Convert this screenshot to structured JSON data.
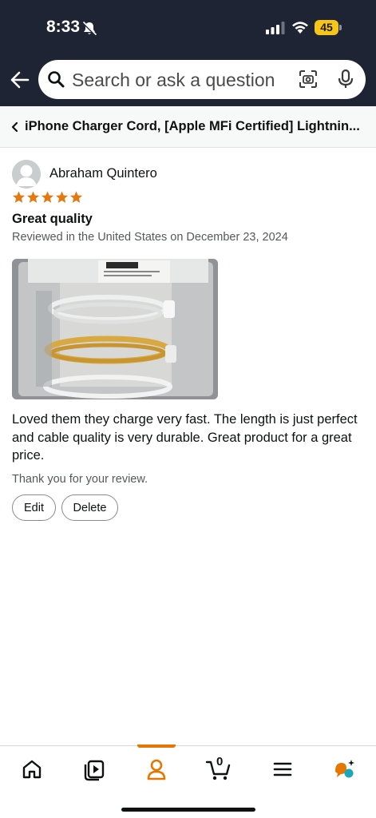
{
  "status_bar": {
    "time": "8:33",
    "battery": "45"
  },
  "search": {
    "placeholder": "Search or ask a question"
  },
  "breadcrumb": {
    "title": "iPhone Charger Cord, [Apple MFi Certified] Lightnin..."
  },
  "review": {
    "reviewer": "Abraham Quintero",
    "rating": 5,
    "rating_max": 5,
    "title": "Great quality",
    "date": "Reviewed in the United States on December 23, 2024",
    "body": "Loved them they charge very fast. The length is just perfect and cable quality is very durable. Great product for a great price.",
    "thanks": "Thank you for your review.",
    "edit_label": "Edit",
    "delete_label": "Delete"
  },
  "bottom_nav": {
    "items": [
      "home-icon",
      "video-icon",
      "account-icon",
      "cart-icon",
      "menu-icon",
      "rufus-icon"
    ],
    "cart_count": "0",
    "active": "account-icon"
  },
  "colors": {
    "header": "#1e2433",
    "star": "#e47911",
    "accent": "#e77600",
    "battery": "#f5c518"
  }
}
